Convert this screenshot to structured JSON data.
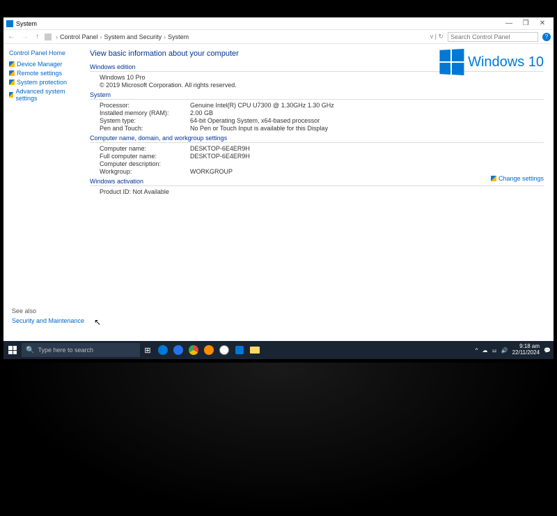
{
  "titlebar": {
    "title": "System"
  },
  "breadcrumbs": [
    "Control Panel",
    "System and Security",
    "System"
  ],
  "search": {
    "placeholder": "Search Control Panel"
  },
  "sidebar": {
    "home": "Control Panel Home",
    "links": [
      "Device Manager",
      "Remote settings",
      "System protection",
      "Advanced system settings"
    ],
    "seealso_title": "See also",
    "seealso_link": "Security and Maintenance"
  },
  "main": {
    "heading": "View basic information about your computer",
    "edition_h": "Windows edition",
    "edition_name": "Windows 10 Pro",
    "edition_copy": "© 2019 Microsoft Corporation. All rights reserved.",
    "brand": "Windows 10",
    "system_h": "System",
    "system_rows": [
      {
        "k": "Processor:",
        "v": "Genuine Intel(R) CPU        U7300  @ 1.30GHz   1.30 GHz"
      },
      {
        "k": "Installed memory (RAM):",
        "v": "2.00 GB"
      },
      {
        "k": "System type:",
        "v": "64-bit Operating System, x64-based processor"
      },
      {
        "k": "Pen and Touch:",
        "v": "No Pen or Touch Input is available for this Display"
      }
    ],
    "name_h": "Computer name, domain, and workgroup settings",
    "name_rows": [
      {
        "k": "Computer name:",
        "v": "DESKTOP-6E4ER9H"
      },
      {
        "k": "Full computer name:",
        "v": "DESKTOP-6E4ER9H"
      },
      {
        "k": "Computer description:",
        "v": ""
      },
      {
        "k": "Workgroup:",
        "v": "WORKGROUP"
      }
    ],
    "change_settings": "Change settings",
    "activation_h": "Windows activation",
    "activation_text": "Product ID: Not Available"
  },
  "taskbar": {
    "search_placeholder": "Type here to search",
    "time": "9:18 am",
    "date": "22/11/2024"
  }
}
